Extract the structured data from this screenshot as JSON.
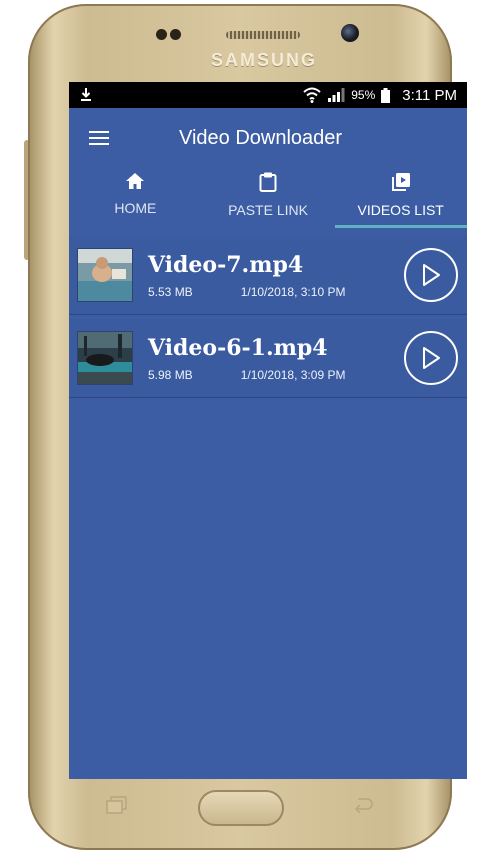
{
  "device": {
    "brand": "SAMSUNG"
  },
  "status_bar": {
    "battery": "95%",
    "time": "3:11 PM"
  },
  "app_bar": {
    "title": "Video Downloader"
  },
  "tabs": [
    {
      "label": "HOME",
      "icon": "home-icon"
    },
    {
      "label": "PASTE LINK",
      "icon": "clipboard-icon"
    },
    {
      "label": "VIDEOS LIST",
      "icon": "video-library-icon",
      "selected": true
    }
  ],
  "videos": [
    {
      "name": "Video-7.mp4",
      "size": "5.53 MB",
      "date": "1/10/2018, 3:10 PM"
    },
    {
      "name": "Video-6-1.mp4",
      "size": "5.98 MB",
      "date": "1/10/2018, 3:09 PM"
    }
  ],
  "colors": {
    "background": "#3c5da3",
    "tab_indicator": "#5fb0c4",
    "status_bar": "#000000"
  }
}
